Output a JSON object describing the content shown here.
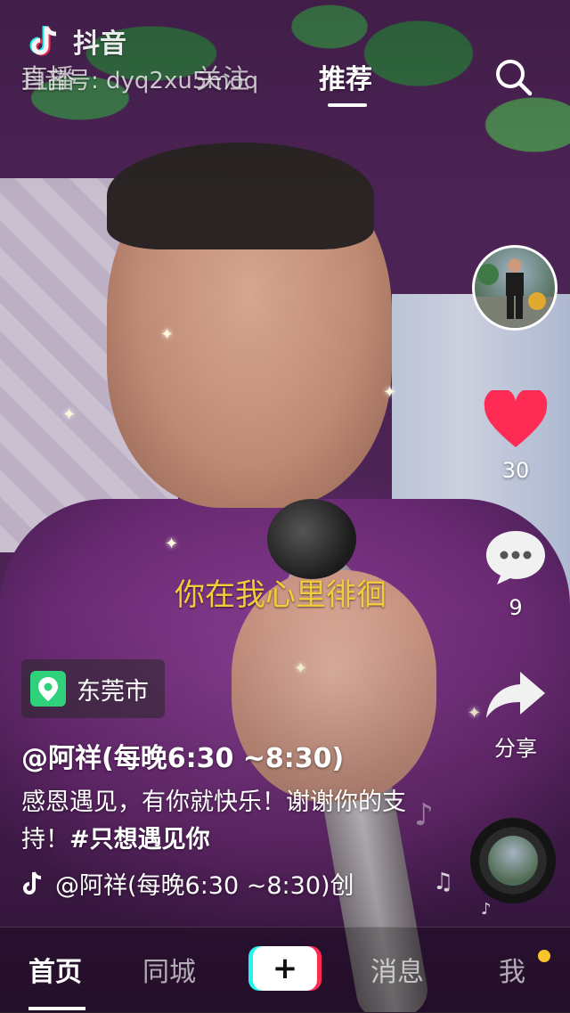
{
  "app": {
    "logo_text": "抖音",
    "douyin_id": "抖音号: dyq2xu5moq"
  },
  "top_tabs": [
    {
      "label": "直播"
    },
    {
      "label": "关注"
    },
    {
      "label": "推荐",
      "active": true
    }
  ],
  "rail": {
    "like_count": "30",
    "comment_count": "9",
    "share_label": "分享"
  },
  "lyric": "你在我心里徘徊",
  "poi": {
    "label": "东莞市"
  },
  "author": "@阿祥(每晚6:30 ~8:30)",
  "description": {
    "text": "感恩遇见，有你就快乐！谢谢你的支持！",
    "hashtag": "#只想遇见你"
  },
  "music": {
    "title": "@阿祥(每晚6:30 ~8:30)创"
  },
  "nav": {
    "home": "首页",
    "city": "同城",
    "plus": "+",
    "messages": "消息",
    "me": "我"
  },
  "colors": {
    "like": "#fe2c55",
    "lyric": "#f2cc3a",
    "poi_icon": "#2fd27a",
    "notify_dot": "#f7c52b"
  },
  "icons": [
    "douyin-logo-icon",
    "search-icon",
    "heart-icon",
    "comment-icon",
    "share-icon",
    "location-pin-icon",
    "music-note-icon"
  ]
}
